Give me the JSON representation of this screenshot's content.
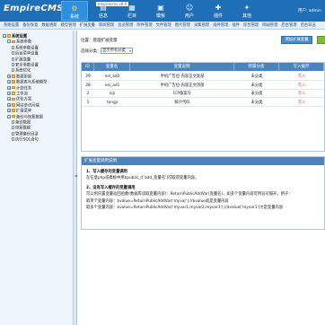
{
  "brand": {
    "logo": "EmpireCMS"
  },
  "topbar": {
    "white_tag": "empirecms v8.0",
    "user_info": "用户: admin",
    "nav": [
      {
        "label": "系统",
        "icon": "gear-icon",
        "active": true
      },
      {
        "label": "信息",
        "icon": "info-icon",
        "active": false
      },
      {
        "label": "栏目",
        "icon": "column-icon",
        "active": false
      },
      {
        "label": "模板",
        "icon": "template-icon",
        "active": false
      },
      {
        "label": "用户",
        "icon": "user-icon",
        "active": false
      },
      {
        "label": "插件",
        "icon": "plugin-icon",
        "active": false
      },
      {
        "label": "其他",
        "icon": "other-icon",
        "active": false
      }
    ]
  },
  "subbar": {
    "items": [
      "系统设置",
      "备份恢复",
      "数据更新",
      "模型管理",
      "扩展变量",
      "新闻管理",
      "会员管理",
      "附件管理",
      "文件管理",
      "图片管理",
      "采集管理",
      "插件管理",
      "插件",
      "综合管理",
      "网站管理",
      "后台管理",
      "后台日志"
    ]
  },
  "sidebar": {
    "items": [
      {
        "label": "系统设置",
        "level": 0,
        "type": "root"
      },
      {
        "label": "系统参数",
        "level": 1,
        "type": "folder"
      },
      {
        "label": "系统参数设置",
        "level": 2,
        "type": "doc"
      },
      {
        "label": "后台菜单设置",
        "level": 2,
        "type": "doc"
      },
      {
        "label": "扩展变量",
        "level": 2,
        "type": "doc"
      },
      {
        "label": "安全参数设置",
        "level": 2,
        "type": "doc"
      },
      {
        "label": "系统优化",
        "level": 2,
        "type": "doc"
      },
      {
        "label": "数据更新",
        "level": 1,
        "type": "folder"
      },
      {
        "label": "数据表与系统模型",
        "level": 1,
        "type": "folder"
      },
      {
        "label": "计划任务",
        "level": 1,
        "type": "folder"
      },
      {
        "label": "工作流",
        "level": 1,
        "type": "folder"
      },
      {
        "label": "优化方案",
        "level": 1,
        "type": "folder"
      },
      {
        "label": "网站多访问端",
        "level": 1,
        "type": "folder"
      },
      {
        "label": "扩展菜单",
        "level": 1,
        "type": "folder"
      },
      {
        "label": "备份与恢复数据",
        "level": 1,
        "type": "folder"
      },
      {
        "label": "备份数据",
        "level": 2,
        "type": "doc"
      },
      {
        "label": "恢复数据",
        "level": 2,
        "type": "doc"
      },
      {
        "label": "管理备份目录",
        "level": 2,
        "type": "doc"
      },
      {
        "label": "执行SQL语句",
        "level": 2,
        "type": "doc"
      }
    ]
  },
  "main": {
    "location": "位置：管理扩展变量",
    "select_label": "选择分类：",
    "select_value": "显示所有分类",
    "add_button": "增加扩展变量",
    "headers": [
      "ID",
      "变量名",
      "变量说明",
      "所属分类",
      "写入缓存"
    ],
    "rows": [
      [
        "29",
        "nei_ad2",
        "手机广告位-内容正文底部",
        "未分类",
        "写入"
      ],
      [
        "28",
        "nei_ad1",
        "手机广告位-内容正文顶部",
        "未分类",
        "写入"
      ],
      [
        "2",
        "icp",
        "ICP备案号",
        "未分类",
        "写入"
      ],
      [
        "1",
        "tongji",
        "统计代码",
        "未分类",
        "写入"
      ]
    ],
    "pager": "1"
  },
  "tips": {
    "title": "扩展变量调用说明",
    "lines": [
      {
        "text": "1、写入缓存的变量调用",
        "bold": true
      },
      {
        "text": "在任意php或模板中用$public_r['add_变量名']可取得变量内容。",
        "bold": false
      },
      {
        "text": "2、没有写入缓存的变量调用",
        "bold": true
      },
      {
        "text": "可以用内置变量返回函数(数据库读取变量内容)：ReturnPublicAddVar(变量名)，如多个变量内容可用逗号隔开，例子：",
        "bold": false
      },
      {
        "text": "取单个变量内容：$value=ReturnPublicAddVar('myvar');//$value就是变量内容",
        "bold": false
      },
      {
        "text": "取多个变量内容：$value=ReturnPublicAddVar('myvar1,myvar2,myvar3');//$value['myvar1']才是变量内容",
        "bold": false
      }
    ]
  }
}
